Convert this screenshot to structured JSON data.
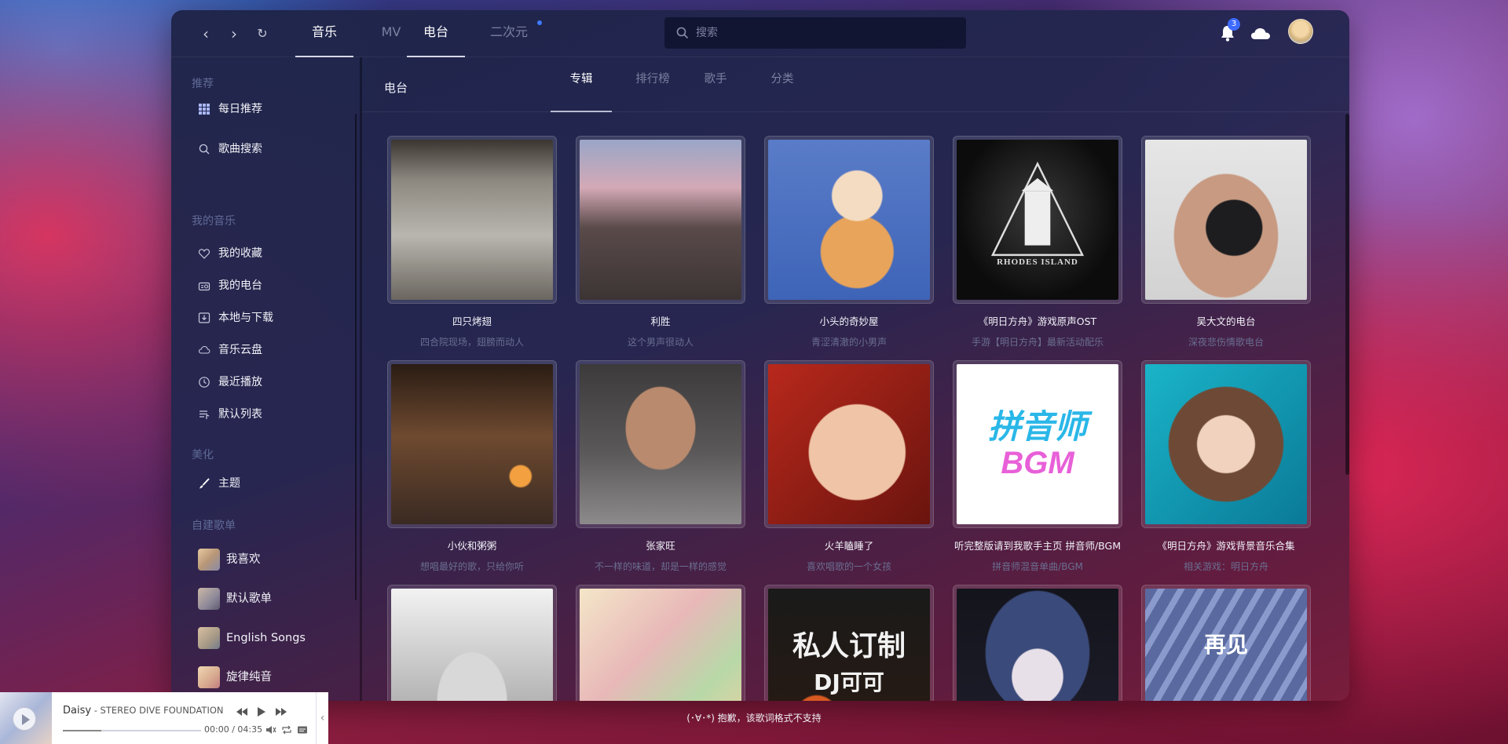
{
  "top_nav": {
    "tabs": [
      {
        "label": "音乐",
        "active": true
      },
      {
        "label": "MV",
        "active": false
      },
      {
        "label": "电台",
        "active": true
      },
      {
        "label": "二次元",
        "active": false,
        "dot": true
      }
    ],
    "search_placeholder": "搜索",
    "notification_count": "3"
  },
  "sidebar": {
    "groups": [
      {
        "title": "推荐",
        "items": [
          {
            "label": "每日推荐",
            "icon": "grid-icon"
          },
          {
            "label": "歌曲搜索",
            "icon": "search-icon"
          }
        ]
      },
      {
        "title": "我的音乐",
        "items": [
          {
            "label": "我的收藏",
            "icon": "heart-icon"
          },
          {
            "label": "我的电台",
            "icon": "radio-icon"
          },
          {
            "label": "本地与下载",
            "icon": "download-icon"
          },
          {
            "label": "音乐云盘",
            "icon": "cloud-icon"
          },
          {
            "label": "最近播放",
            "icon": "clock-icon"
          },
          {
            "label": "默认列表",
            "icon": "list-icon"
          }
        ]
      },
      {
        "title": "美化",
        "items": [
          {
            "label": "主题",
            "icon": "brush-icon"
          }
        ]
      },
      {
        "title": "自建歌单",
        "playlists": [
          {
            "label": "我喜欢"
          },
          {
            "label": "默认歌单"
          },
          {
            "label": "English Songs"
          },
          {
            "label": "旋律纯音"
          }
        ]
      }
    ]
  },
  "content": {
    "title": "电台",
    "tabs": [
      {
        "label": "专辑",
        "active": true
      },
      {
        "label": "排行榜",
        "active": false
      },
      {
        "label": "歌手",
        "active": false
      },
      {
        "label": "分类",
        "active": false
      }
    ],
    "cards": [
      {
        "title": "四只烤翅",
        "desc": "四合院现场，翅膀而动人",
        "cover": "a"
      },
      {
        "title": "利胜",
        "desc": "这个男声很动人",
        "cover": "b"
      },
      {
        "title": "小头的奇妙屋",
        "desc": "青涩清澈的小男声",
        "cover": "c"
      },
      {
        "title": "《明日方舟》游戏原声OST",
        "desc": "手游【明日方舟】最新活动配乐",
        "cover": "d",
        "cover_text": "RHODES ISLAND"
      },
      {
        "title": "吴大文的电台",
        "desc": "深夜悲伤情歌电台",
        "cover": "e"
      },
      {
        "title": "小伙和粥粥",
        "desc": "想唱最好的歌，只给你听",
        "cover": "f"
      },
      {
        "title": "张家旺",
        "desc": "不一样的味道，却是一样的感觉",
        "cover": "g"
      },
      {
        "title": "火羊瞌睡了",
        "desc": "喜欢唱歌的一个女孩",
        "cover": "h"
      },
      {
        "title": "听完整版请到我歌手主页 拼音师/BGM",
        "desc": "拼音师混音单曲/BGM",
        "cover": "i",
        "cover_text": "拼音师",
        "cover_text2": "BGM"
      },
      {
        "title": "《明日方舟》游戏背景音乐合集",
        "desc": "相关游戏：明日方舟",
        "cover": "j"
      },
      {
        "title": "",
        "desc": "",
        "cover": "k"
      },
      {
        "title": "",
        "desc": "",
        "cover": "l"
      },
      {
        "title": "",
        "desc": "",
        "cover": "m",
        "cover_text": "私人订制",
        "cover_text2": "DJ可可"
      },
      {
        "title": "",
        "desc": "",
        "cover": "n"
      },
      {
        "title": "",
        "desc": "",
        "cover": "o",
        "cover_text": "再见"
      }
    ]
  },
  "player": {
    "song": "Daisy",
    "separator": " - ",
    "artist": "STEREO DIVE FOUNDATION",
    "time": "00:00 / 04:35",
    "progress": 0.28
  },
  "lyric": "(･∀･*) 抱歉，该歌词格式不支持",
  "colors": {
    "accent": "#3d6bff",
    "active_text": "#ffffff",
    "muted_text": "#7c80a0"
  }
}
